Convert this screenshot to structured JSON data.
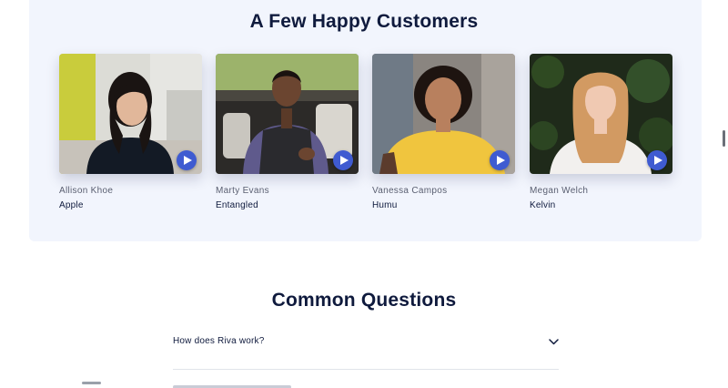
{
  "customers_section": {
    "title": "A Few Happy Customers",
    "customers": [
      {
        "name": "Allison Khoe",
        "company": "Apple"
      },
      {
        "name": "Marty Evans",
        "company": "Entangled"
      },
      {
        "name": "Vanessa Campos",
        "company": "Humu"
      },
      {
        "name": "Megan Welch",
        "company": "Kelvin"
      }
    ]
  },
  "faq_section": {
    "title": "Common Questions",
    "questions": [
      {
        "question": "How does Riva work?"
      }
    ]
  },
  "icons": {
    "play": "play-icon",
    "chevron": "chevron-down-icon"
  },
  "colors": {
    "accent": "#3f5bd1",
    "heading": "#0f1a3d",
    "panel_bg": "#f2f5fd"
  }
}
